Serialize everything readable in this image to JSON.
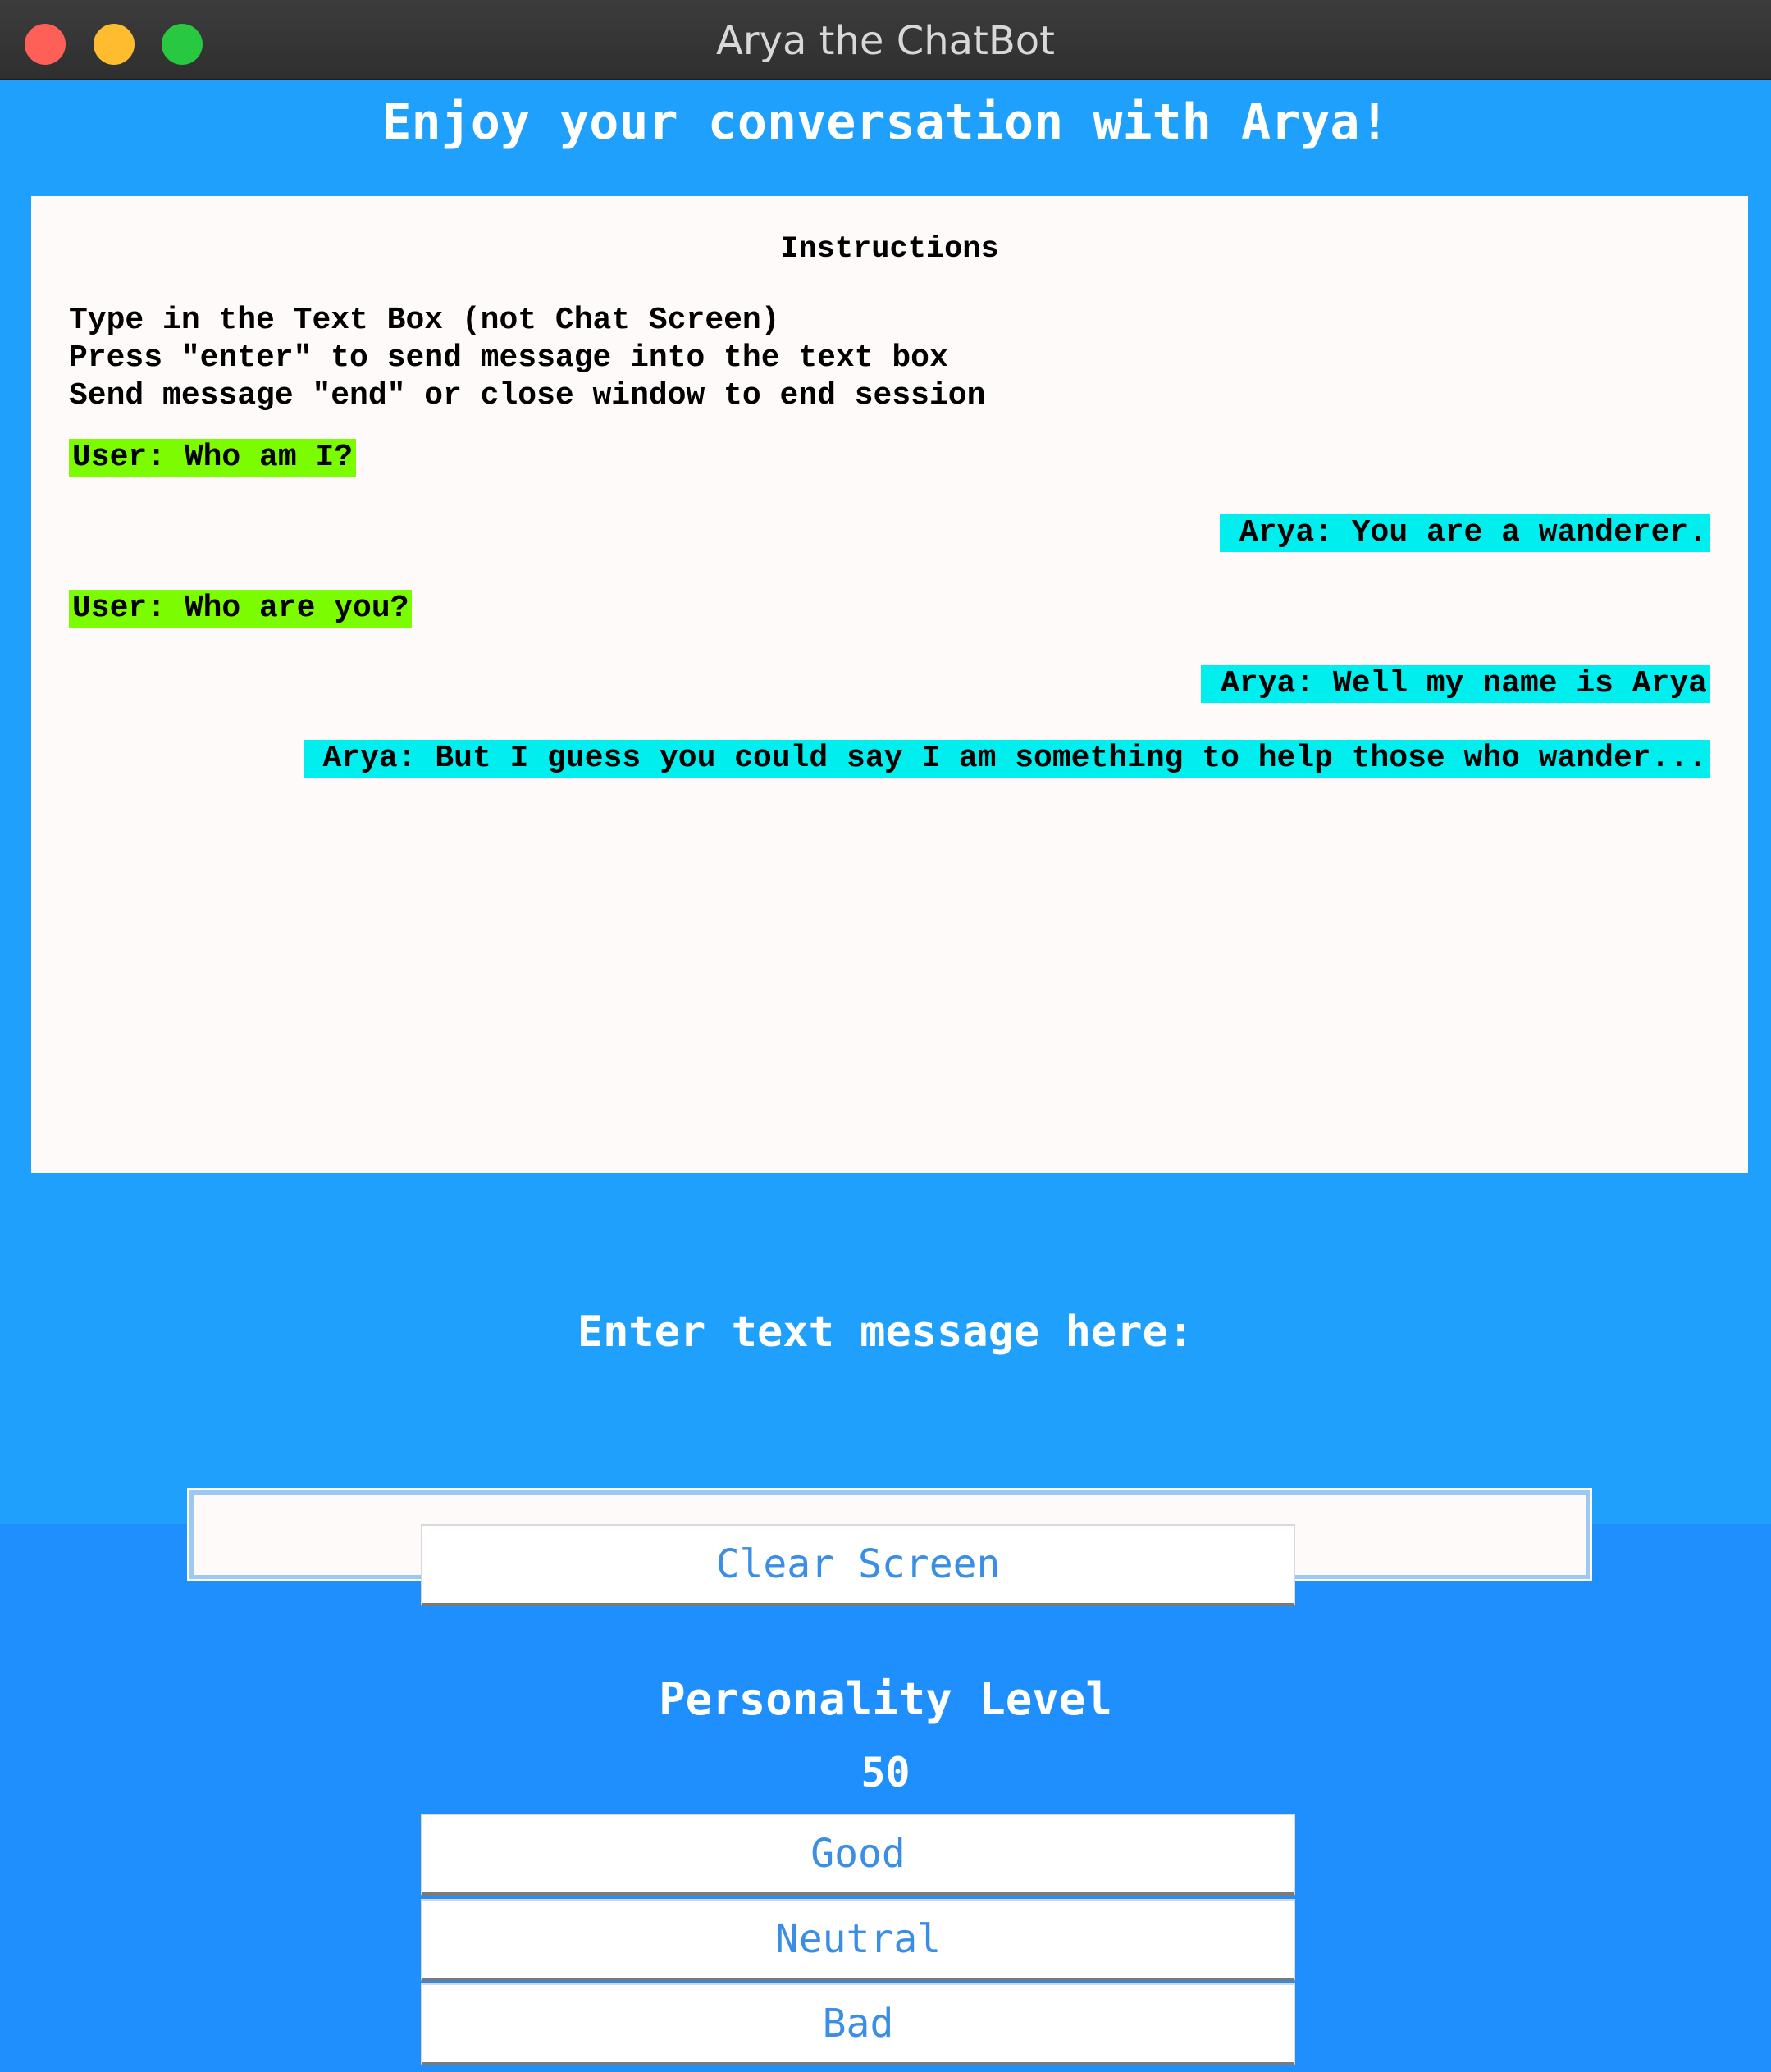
{
  "window": {
    "title": "Arya the ChatBot"
  },
  "header": {
    "heading": "Enjoy your conversation with Arya!"
  },
  "chat": {
    "instructions_title": "Instructions",
    "instructions": [
      "Type in the Text Box (not Chat Screen)",
      "Press \"enter\" to send message into the text box",
      "Send message \"end\" or close window to end session"
    ],
    "messages": [
      {
        "sender": "user",
        "text": "User: Who am I?"
      },
      {
        "sender": "bot",
        "text": "Arya: You are a wanderer."
      },
      {
        "sender": "user",
        "text": "User: Who are you?"
      },
      {
        "sender": "bot",
        "text": "Arya: Well my name is Arya"
      },
      {
        "sender": "bot",
        "text": "Arya: But I guess you could say I am something to help those who wander..."
      }
    ],
    "colors": {
      "user_highlight": "#7cfc00",
      "bot_highlight": "#00eeee"
    }
  },
  "input": {
    "prompt": "Enter text message here:",
    "value": ""
  },
  "controls": {
    "clear_label": "Clear Screen",
    "personality_label": "Personality Level",
    "personality_value": "50",
    "good_label": "Good",
    "neutral_label": "Neutral",
    "bad_label": "Bad"
  }
}
